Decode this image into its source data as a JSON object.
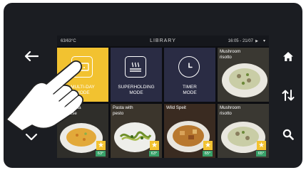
{
  "status_bar": {
    "temperature": "63/63°C",
    "title": "LIBRARY",
    "time": "16:05 - 21/07"
  },
  "mode_tiles": [
    {
      "label": "MULTI-DAY\nMODE",
      "icon": "multiday-icon",
      "active": true
    },
    {
      "label": "SUPERHOLDING\nMODE",
      "icon": "steam-tray-icon",
      "active": false
    },
    {
      "label": "TIMER\nMODE",
      "icon": "clock-icon",
      "active": false
    }
  ],
  "recipes": [
    {
      "name": "Mushroom\nrisotto",
      "temp": "",
      "star": false
    },
    {
      "name": "Risotto alla\nMilanese",
      "temp": "63°",
      "star": true
    },
    {
      "name": "Pasta with\npesto",
      "temp": "63°",
      "star": true
    },
    {
      "name": "Wild Speit",
      "temp": "65°",
      "star": true
    },
    {
      "name": "Mushroom\nrisotto",
      "temp": "65°",
      "star": true
    }
  ],
  "side_buttons": {
    "left": [
      "back-arrow-icon",
      "chevron-down-icon"
    ],
    "right": [
      "home-icon",
      "sort-icon",
      "search-icon"
    ]
  },
  "colors": {
    "device": "#1b1d22",
    "active_tile": "#f2c230",
    "mode_tile": "#2a2c44",
    "temp_badge": "#38a169"
  }
}
